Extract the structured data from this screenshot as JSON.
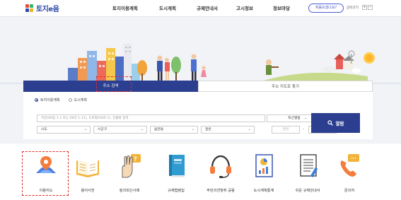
{
  "header": {
    "logo_text": "토지e음",
    "nav": [
      "토지이용계획",
      "도시계획",
      "규제안내서",
      "고시정보",
      "정보마당"
    ],
    "first_visit_label": "처음오셨나요?",
    "font_size_label": "글자크기",
    "font_plus": "+",
    "font_minus": "−"
  },
  "search": {
    "tabs": [
      "주소 검색",
      "주소 지도로 찾기"
    ],
    "radios": [
      "토지이용계획",
      "도시계획"
    ],
    "selected_radio": "토지이용계획",
    "address_placeholder": "지번(00동 1-1 또는 00리 1-11), 도로명(00로 1), 건물명 입력",
    "recent_label": "최근열람",
    "selects": [
      "시도",
      "시군구",
      "읍면동",
      "일반"
    ],
    "main_lot_placeholder": "본번",
    "sub_lot_placeholder": "부번",
    "dash": "-",
    "search_button": "열람"
  },
  "quick_menu": [
    {
      "label": "이용지도",
      "icon": "map-pin-icon"
    },
    {
      "label": "용어사전",
      "icon": "open-book-icon"
    },
    {
      "label": "질의회신사례",
      "icon": "question-hand-icon"
    },
    {
      "label": "규제법령집",
      "icon": "law-book-icon"
    },
    {
      "label": "주민의견청취 공람",
      "icon": "headset-icon"
    },
    {
      "label": "도시계획통계",
      "icon": "statistics-chart-icon"
    },
    {
      "label": "쉬운 규제안내서",
      "icon": "guide-document-icon"
    },
    {
      "label": "문의처",
      "icon": "phone-icon"
    }
  ],
  "colors": {
    "primary": "#2c3e8f",
    "highlight": "#e32a2a",
    "accent_blue": "#4e5bd6"
  }
}
